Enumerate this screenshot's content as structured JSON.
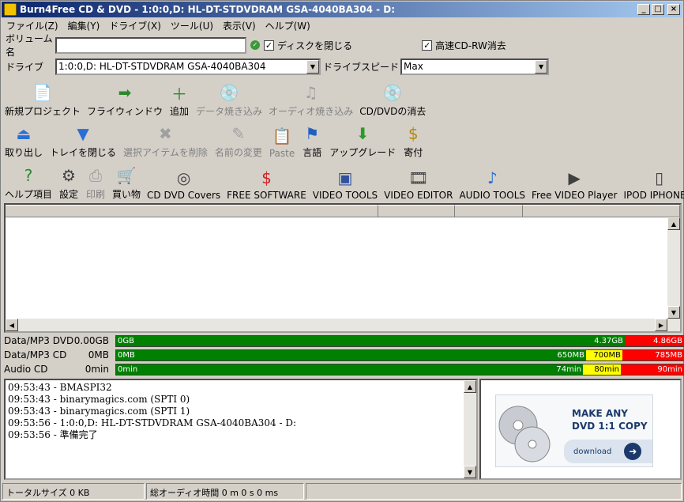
{
  "title": "Burn4Free CD & DVD - 1:0:0,D: HL-DT-STDVDRAM GSA-4040BA304 - D:",
  "menu": [
    "ファイル(Z)",
    "編集(Y)",
    "ドライブ(X)",
    "ツール(U)",
    "表示(V)",
    "ヘルプ(W)"
  ],
  "volume": {
    "label": "ボリューム名",
    "value": "",
    "close_disc": "ディスクを閉じる",
    "fast_erase": "高速CD-RW消去"
  },
  "drive": {
    "label": "ドライブ",
    "value": "1:0:0,D: HL-DT-STDVDRAM GSA-4040BA304",
    "speed_label": "ドライブスピード",
    "speed_value": "Max"
  },
  "toolbar1": [
    {
      "label": "新規プロジェクト",
      "icon": "new-project-icon",
      "enabled": true
    },
    {
      "label": "フライウィンドウ",
      "icon": "fly-window-icon",
      "enabled": true
    },
    {
      "label": "追加",
      "icon": "add-icon",
      "enabled": true
    },
    {
      "label": "データ焼き込み",
      "icon": "burn-data-icon",
      "enabled": false
    },
    {
      "label": "オーディオ焼き込み",
      "icon": "burn-audio-icon",
      "enabled": false
    },
    {
      "label": "CD/DVDの消去",
      "icon": "erase-disc-icon",
      "enabled": true
    }
  ],
  "toolbar2": [
    {
      "label": "取り出し",
      "icon": "eject-icon",
      "enabled": true
    },
    {
      "label": "トレイを閉じる",
      "icon": "close-tray-icon",
      "enabled": true
    },
    {
      "label": "選択アイテムを削除",
      "icon": "delete-icon",
      "enabled": false
    },
    {
      "label": "名前の変更",
      "icon": "rename-icon",
      "enabled": false
    },
    {
      "label": "Paste",
      "icon": "paste-icon",
      "enabled": false
    },
    {
      "label": "言語",
      "icon": "language-flag-icon",
      "enabled": true
    },
    {
      "label": "アップグレード",
      "icon": "upgrade-icon",
      "enabled": true
    },
    {
      "label": "寄付",
      "icon": "donate-icon",
      "enabled": true
    }
  ],
  "toolbar3": [
    {
      "label": "ヘルプ項目",
      "icon": "help-icon",
      "enabled": true
    },
    {
      "label": "設定",
      "icon": "settings-icon",
      "enabled": true
    },
    {
      "label": "印刷",
      "icon": "print-icon",
      "enabled": false
    },
    {
      "label": "買い物",
      "icon": "shopping-icon",
      "enabled": true
    },
    {
      "label": "CD DVD Covers",
      "icon": "covers-icon",
      "enabled": true
    },
    {
      "label": "FREE SOFTWARE",
      "icon": "free-software-icon",
      "enabled": true
    },
    {
      "label": "VIDEO TOOLS",
      "icon": "video-tools-icon",
      "enabled": true
    },
    {
      "label": "VIDEO EDITOR",
      "icon": "video-editor-icon",
      "enabled": true
    },
    {
      "label": "AUDIO TOOLS",
      "icon": "audio-tools-icon",
      "enabled": true
    },
    {
      "label": "Free VIDEO Player",
      "icon": "video-player-icon",
      "enabled": true
    },
    {
      "label": "IPOD IPHONE T",
      "icon": "ipod-icon",
      "enabled": true
    }
  ],
  "capacity": [
    {
      "label": "Data/MP3 DVD",
      "value": "0.00GB",
      "start": "0GB",
      "mark1": "4.37GB",
      "mark2": "",
      "mark3": "4.86GB",
      "green": 0.896,
      "yellow": 0,
      "red": 0.104
    },
    {
      "label": "Data/MP3 CD",
      "value": "0MB",
      "start": "0MB",
      "mark1": "650MB",
      "mark2": "700MB",
      "mark3": "785MB",
      "green": 0.828,
      "yellow": 0.064,
      "red": 0.108
    },
    {
      "label": "Audio CD",
      "value": "0min",
      "start": "0min",
      "mark1": "74min",
      "mark2": "80min",
      "mark3": "90min",
      "green": 0.822,
      "yellow": 0.067,
      "red": 0.111
    }
  ],
  "log": [
    "09:53:43 - BMASPI32",
    "09:53:43 - binarymagics.com (SPTI 0)",
    "09:53:43 - binarymagics.com (SPTI 1)",
    "09:53:56 - 1:0:0,D: HL-DT-STDVDRAM GSA-4040BA304 - D:",
    "09:53:56 - 準備完了"
  ],
  "ad": {
    "line1": "MAKE ANY",
    "line2": "DVD 1:1 COPY",
    "button": "download"
  },
  "status": {
    "total_size": "トータルサイズ 0 KB",
    "total_audio": "総オーディオ時間 0 m 0 s 0 ms"
  },
  "colors": {
    "green": "#008000",
    "yellow": "#ffff00",
    "red": "#ff0000",
    "title_start": "#0a246a",
    "title_end": "#a6caf0"
  }
}
